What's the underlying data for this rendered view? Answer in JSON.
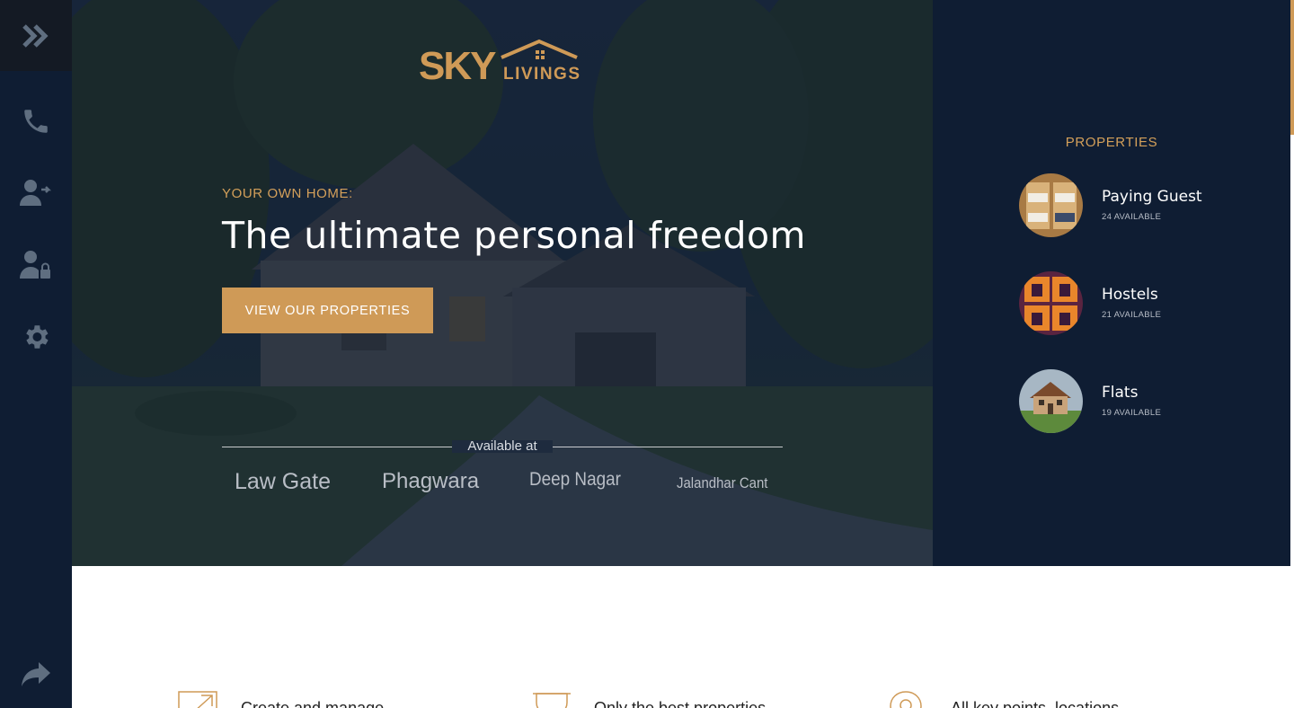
{
  "brand": {
    "name_main": "SKY",
    "name_sub": "LIVINGS",
    "accent": "#cf9a57"
  },
  "rail": {
    "items": [
      {
        "icon": "expand-chevrons-icon"
      },
      {
        "icon": "phone-icon"
      },
      {
        "icon": "user-login-icon"
      },
      {
        "icon": "user-lock-icon"
      },
      {
        "icon": "gear-icon"
      },
      {
        "icon": "share-icon"
      }
    ]
  },
  "hero": {
    "eyebrow": "YOUR OWN HOME:",
    "headline": "The ultimate personal freedom",
    "cta_label": "VIEW OUR PROPERTIES",
    "available_label": "Available at",
    "locations": [
      "Law Gate",
      "Phagwara",
      "Deep Nagar",
      "Jalandhar Cant"
    ]
  },
  "properties": {
    "title": "PROPERTIES",
    "items": [
      {
        "name": "Paying Guest",
        "count": "24 AVAILABLE"
      },
      {
        "name": "Hostels",
        "count": "21 AVAILABLE"
      },
      {
        "name": "Flats",
        "count": "19 AVAILABLE"
      }
    ]
  },
  "features": {
    "items": [
      {
        "icon": "external-link-icon",
        "label": "Create and manage"
      },
      {
        "icon": "trophy-icon",
        "label": "Only the best properties"
      },
      {
        "icon": "map-pin-icon",
        "label": "All key points, locations"
      }
    ]
  },
  "colors": {
    "navy": "#0f1d33",
    "gold": "#d4a05a"
  }
}
